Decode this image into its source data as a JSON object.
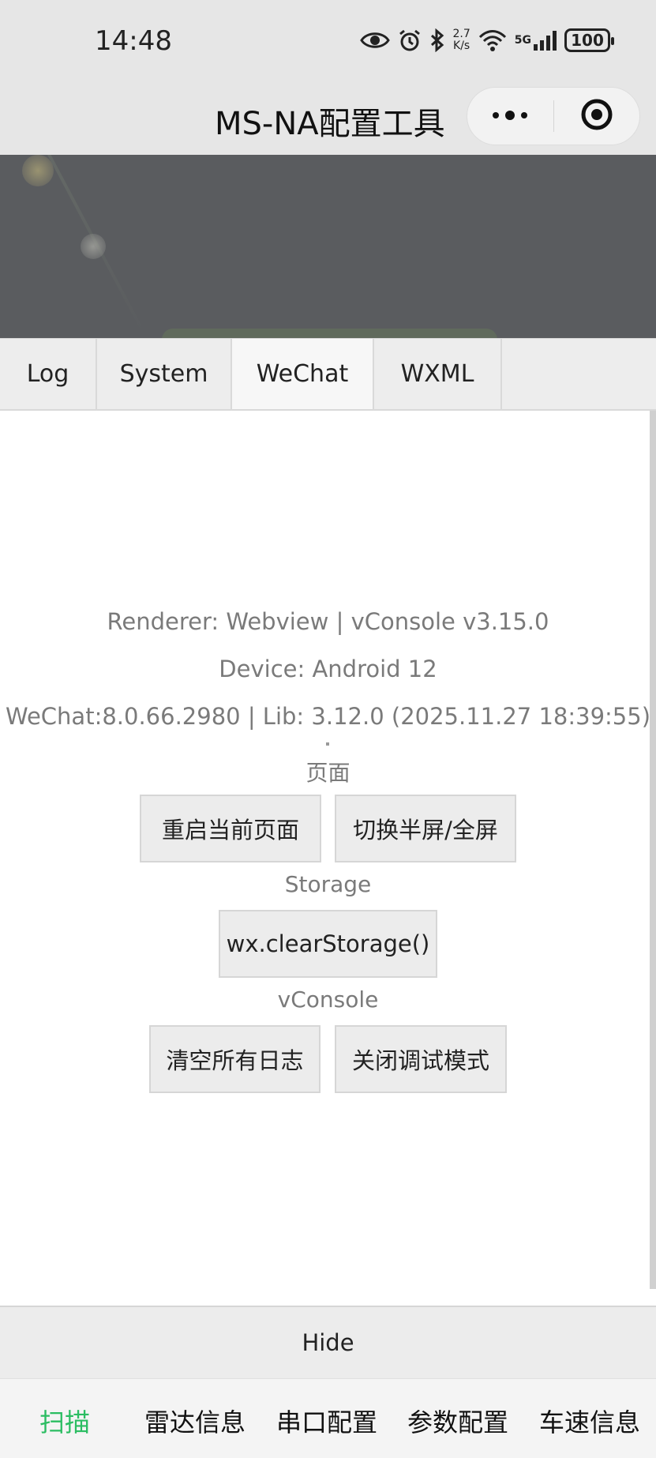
{
  "status_bar": {
    "time": "14:48",
    "net_speed_value": "2.7",
    "net_speed_unit": "K/s",
    "network": "5G",
    "battery": "100"
  },
  "nav": {
    "title": "MS-NA配置工具"
  },
  "console": {
    "tabs": [
      "Log",
      "System",
      "WeChat",
      "WXML"
    ],
    "active_tab": "WeChat",
    "info": {
      "renderer": "Renderer: Webview | vConsole v3.15.0",
      "device": "Device: Android 12",
      "wechat": "WeChat:8.0.66.2980 | Lib: 3.12.0 (2025.11.27 18:39:55)"
    },
    "sections": {
      "page_label": "页面",
      "reload_button": "重启当前页面",
      "toggle_button": "切换半屏/全屏",
      "storage_label": "Storage",
      "clear_storage_button": "wx.clearStorage()",
      "vconsole_label": "vConsole",
      "clear_logs_button": "清空所有日志",
      "close_debug_button": "关闭调试模式"
    },
    "hide_label": "Hide"
  },
  "tabbar": {
    "items": [
      "扫描",
      "雷达信息",
      "串口配置",
      "参数配置",
      "车速信息"
    ],
    "active_color": "#2bbd62"
  }
}
